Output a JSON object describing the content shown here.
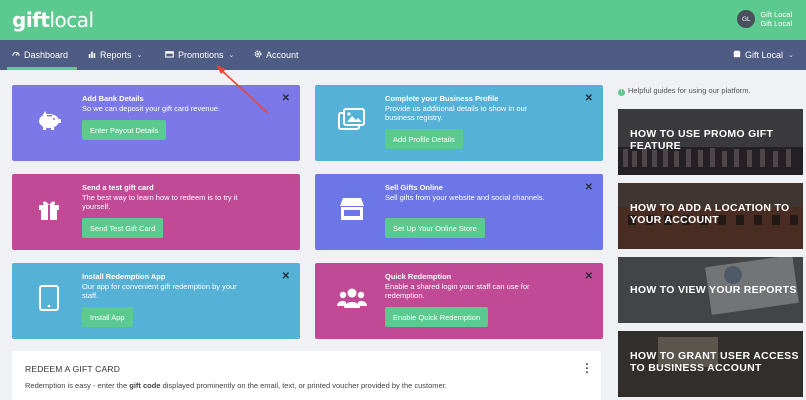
{
  "brand": {
    "logo_bold": "gift",
    "logo_light": "local"
  },
  "user": {
    "initials": "GL",
    "line1": "Gift Local",
    "line2": "Gift Local"
  },
  "nav": {
    "dashboard": "Dashboard",
    "reports": "Reports",
    "promotions": "Promotions",
    "account": "Account",
    "store": "Gift Local"
  },
  "cards": [
    {
      "title": "Add Bank Details",
      "desc": "So we can deposit your gift card revenue.",
      "button": "Enter Payout Details"
    },
    {
      "title": "Complete your Business Profile",
      "desc": "Provide us additional details to show in our business registry.",
      "button": "Add Profile Details"
    },
    {
      "title": "Send a test gift card",
      "desc": "The best way to learn how to redeem is to try it yourself.",
      "button": "Send Test Gift Card"
    },
    {
      "title": "Sell Gifts Online",
      "desc": "Sell gifts from your website and social channels.",
      "button": "Set Up Your Online Store"
    },
    {
      "title": "Install Redemption App",
      "desc": "Our app for convenient gift redemption by your staff.",
      "button": "Install App"
    },
    {
      "title": "Quick Redemption",
      "desc": "Enable a shared login your staff can use for redemption.",
      "button": "Enable Quick Redemption"
    }
  ],
  "redeem": {
    "title": "REDEEM A GIFT CARD",
    "desc_pre": "Redemption is easy - enter the ",
    "desc_bold": "gift code",
    "desc_post": " displayed prominently on the email, text, or printed voucher provided by the customer."
  },
  "help": {
    "note": "Helpful guides for using our platform."
  },
  "guides": [
    {
      "label": "HOW TO USE PROMO GIFT FEATURE"
    },
    {
      "label": "HOW TO ADD A LOCATION TO YOUR ACCOUNT"
    },
    {
      "label": "HOW TO VIEW YOUR REPORTS"
    },
    {
      "label": "HOW TO GRANT USER ACCESS TO BUSINESS ACCOUNT"
    }
  ],
  "icons": {
    "card0": "piggy-bank-icon",
    "card1": "images-icon",
    "card2": "gift-icon",
    "card3": "storefront-icon",
    "card4": "tablet-icon",
    "card5": "users-icon"
  },
  "colors": {
    "brand": "#5cc98e",
    "nav": "#4e5b83",
    "purple": "#7c78e8",
    "blue": "#56b1d7",
    "magenta": "#c04a96",
    "indigo": "#6d76e6",
    "annotation": "#e8473a"
  }
}
